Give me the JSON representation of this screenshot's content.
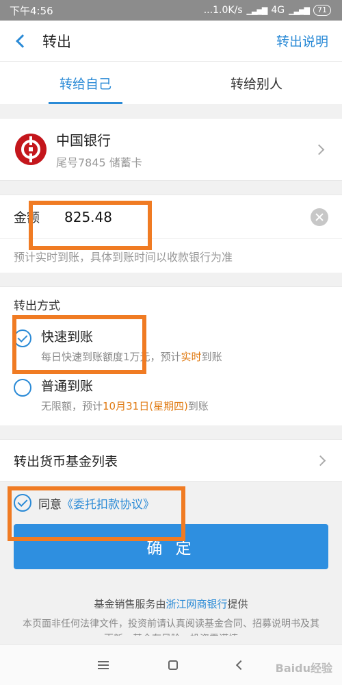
{
  "status_bar": {
    "time": "下午4:56",
    "network_speed": "...1.0K/s",
    "network_type": "4G",
    "battery": "71"
  },
  "nav": {
    "title": "转出",
    "action": "转出说明"
  },
  "tabs": [
    {
      "label": "转给自己",
      "active": true
    },
    {
      "label": "转给别人",
      "active": false
    }
  ],
  "bank": {
    "name": "中国银行",
    "card_info": "尾号7845 储蓄卡"
  },
  "amount": {
    "label": "金额",
    "value": "825.48",
    "note": "预计实时到账，具体到账时间以收款银行为准"
  },
  "method": {
    "title": "转出方式",
    "options": [
      {
        "title": "快速到账",
        "desc_pre": "每日快速到账额度1万元，预计",
        "desc_highlight": "实时",
        "desc_post": "到账",
        "checked": true
      },
      {
        "title": "普通到账",
        "desc_pre": "无限额，预计",
        "desc_highlight": "10月31日(星期四)",
        "desc_post": "到账",
        "checked": false
      }
    ]
  },
  "fund_list": {
    "label": "转出货币基金列表"
  },
  "agreement": {
    "prefix": "同意",
    "link": "《委托扣款协议》"
  },
  "confirm": {
    "label": "确 定"
  },
  "footer": {
    "provider_pre": "基金销售服务由",
    "provider_bank": "浙江网商银行",
    "provider_post": "提供",
    "disclaimer": "本页面非任何法律文件，投资前请认真阅读基金合同、招募说明书及其更新，基金有风险，投资需谨慎"
  },
  "watermark": "Baidu经验",
  "colors": {
    "accent": "#2a8ad6",
    "highlight": "#e07a12",
    "annotation": "#f07b23",
    "bank_red": "#c4161c"
  }
}
